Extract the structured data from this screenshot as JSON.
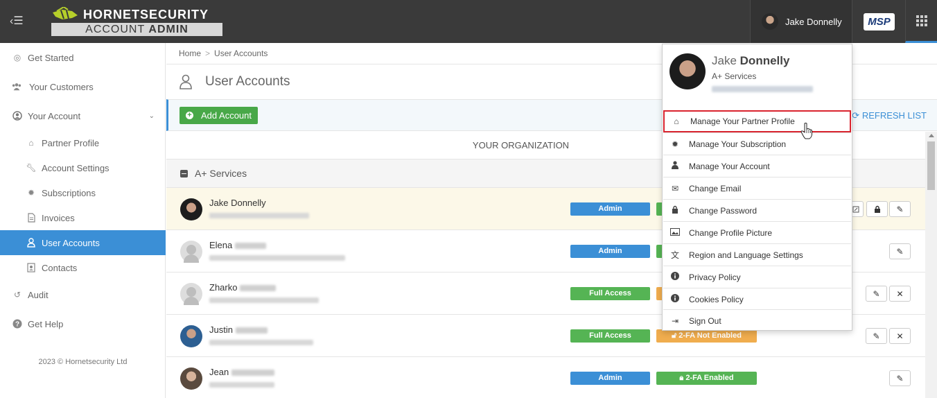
{
  "topbar": {
    "logo_main": "HORNETSECURITY",
    "logo_sub_prefix": "ACCOUNT",
    "logo_sub_bold": "ADMIN",
    "user_name": "Jake Donnelly",
    "msp_label": "MSP"
  },
  "sidebar": {
    "items": [
      {
        "label": "Get Started"
      },
      {
        "label": "Your Customers"
      },
      {
        "label": "Your Account"
      },
      {
        "label": "Partner Profile"
      },
      {
        "label": "Account Settings"
      },
      {
        "label": "Subscriptions"
      },
      {
        "label": "Invoices"
      },
      {
        "label": "User Accounts"
      },
      {
        "label": "Contacts"
      },
      {
        "label": "Audit"
      },
      {
        "label": "Get Help"
      }
    ],
    "copyright": "2023 © Hornetsecurity Ltd"
  },
  "breadcrumb": {
    "home": "Home",
    "separator": ">",
    "current": "User Accounts"
  },
  "page": {
    "title": "User Accounts",
    "add_button": "Add Account",
    "refresh": "REFRESH LIST",
    "org_header": "YOUR ORGANIZATION",
    "group": "A+ Services"
  },
  "users": [
    {
      "first_name": "Jake Donnelly",
      "role": "Admin",
      "twofa": ""
    },
    {
      "first_name": "Elena",
      "role": "Admin",
      "twofa": ""
    },
    {
      "first_name": "Zharko",
      "role": "Full Access",
      "twofa": ""
    },
    {
      "first_name": "Justin",
      "role": "Full Access",
      "twofa": "2-FA Not Enabled"
    },
    {
      "first_name": "Jean",
      "role": "Admin",
      "twofa": "2-FA Enabled"
    }
  ],
  "dropdown": {
    "first_name": "Jake",
    "last_name": "Donnelly",
    "org": "A+ Services",
    "items": [
      {
        "label": "Manage Your Partner Profile",
        "icon": "home-icon"
      },
      {
        "label": "Manage Your Subscription",
        "icon": "certificate-icon"
      },
      {
        "label": "Manage Your Account",
        "icon": "user-icon"
      },
      {
        "label": "Change Email",
        "icon": "envelope-icon"
      },
      {
        "label": "Change Password",
        "icon": "lock-icon"
      },
      {
        "label": "Change Profile Picture",
        "icon": "picture-icon"
      },
      {
        "label": "Region and Language Settings",
        "icon": "language-icon"
      },
      {
        "label": "Privacy Policy",
        "icon": "info-icon"
      },
      {
        "label": "Cookies Policy",
        "icon": "info-icon"
      },
      {
        "label": "Sign Out",
        "icon": "sign-out-icon"
      }
    ]
  },
  "colors": {
    "topbar": "#3a3a3a",
    "accent": "#3b8fd6",
    "green": "#55b454",
    "orange": "#f0ad4e",
    "selected_border": "#d9232e",
    "highlight_row": "#fcf8e8"
  }
}
